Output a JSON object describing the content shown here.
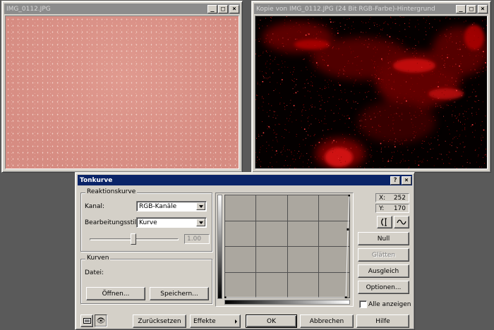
{
  "window1": {
    "title": "IMG_0112.JPG"
  },
  "window2": {
    "title": "Kopie von IMG_0112.JPG  (24 Bit RGB-Farbe)-Hintergrund"
  },
  "title_buttons": {
    "minimize": "_",
    "maximize": "□",
    "close": "×"
  },
  "dialog": {
    "title": "Tonkurve",
    "help": "?",
    "close": "×",
    "reaktion": {
      "title": "Reaktionskurve",
      "kanal_label": "Kanal:",
      "kanal_value": "RGB-Kanäle",
      "stil_label": "Bearbeitungsstil:",
      "stil_value": "Kurve",
      "slider_value": "1.00"
    },
    "kurven": {
      "title": "Kurven",
      "datei_label": "Datei:",
      "open": "Öffnen...",
      "save": "Speichern..."
    },
    "coords": {
      "x_label": "X:",
      "x_value": "252",
      "y_label": "Y:",
      "y_value": "170"
    },
    "buttons": {
      "null": "Null",
      "smooth": "Glätten",
      "balance": "Ausgleich",
      "options": "Optionen...",
      "reset": "Zurücksetzen",
      "effects": "Effekte",
      "ok": "OK",
      "cancel": "Abbrechen",
      "help": "Hilfe"
    },
    "show_all_label": "Alle anzeigen",
    "curve_points": [
      [
        0,
        0
      ],
      [
        248,
        0
      ],
      [
        252,
        170
      ],
      [
        255,
        255
      ]
    ]
  }
}
